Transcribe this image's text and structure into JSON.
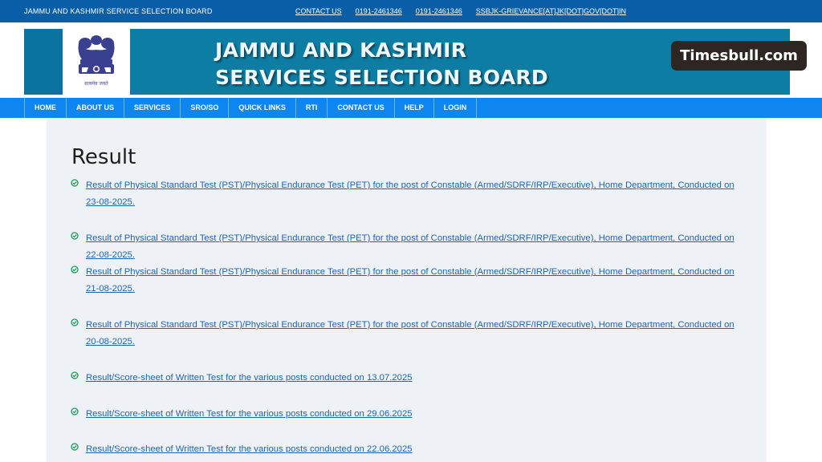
{
  "topbar": {
    "org": "JAMMU AND KASHMIR SERVICE SELECTION BOARD",
    "links": [
      "CONTACT US",
      "0191-2461346",
      "0191-2461346",
      "SSBJK-GRIEVANCE[AT]JK[DOT]GOV[DOT]IN"
    ]
  },
  "banner": {
    "title_line1": "JAMMU AND KASHMIR",
    "title_line2": "SERVICES SELECTION BOARD",
    "emblem_caption": "सत्यमेव जयते"
  },
  "watermark": "Timesbull.com",
  "nav": [
    "HOME",
    "ABOUT US",
    "SERVICES",
    "SRO/SO",
    "QUICK LINKS",
    "RTI",
    "CONTACT US",
    "HELP",
    "LOGIN"
  ],
  "content": {
    "heading": "Result",
    "items": [
      "Result of Physical Standard Test (PST)/Physical Endurance Test (PET) for the post of Constable (Armed/SDRF/IRP/Executive), Home Department, Conducted on 23-08-2025.",
      "Result of Physical Standard Test (PST)/Physical Endurance Test (PET) for the post of Constable (Armed/SDRF/IRP/Executive), Home Department, Conducted on 22-08-2025.",
      "Result of Physical Standard Test (PST)/Physical Endurance Test (PET) for the post of Constable (Armed/SDRF/IRP/Executive), Home Department, Conducted on 21-08-2025.",
      "Result of Physical Standard Test (PST)/Physical Endurance Test (PET) for the post of Constable (Armed/SDRF/IRP/Executive), Home Department, Conducted on 20-08-2025.",
      "Result/Score-sheet of Written Test for the various posts conducted on 13.07.2025",
      "Result/Score-sheet of Written Test for the various posts conducted on 29.06.2025",
      "Result/Score-sheet of Written Test for the various posts conducted on 22.06.2025"
    ]
  },
  "colors": {
    "topbar": "#0a5ea8",
    "banner": "#0d7da3",
    "nav": "#0f86ef",
    "link": "#1e63b6",
    "check": "#1a9b57"
  }
}
